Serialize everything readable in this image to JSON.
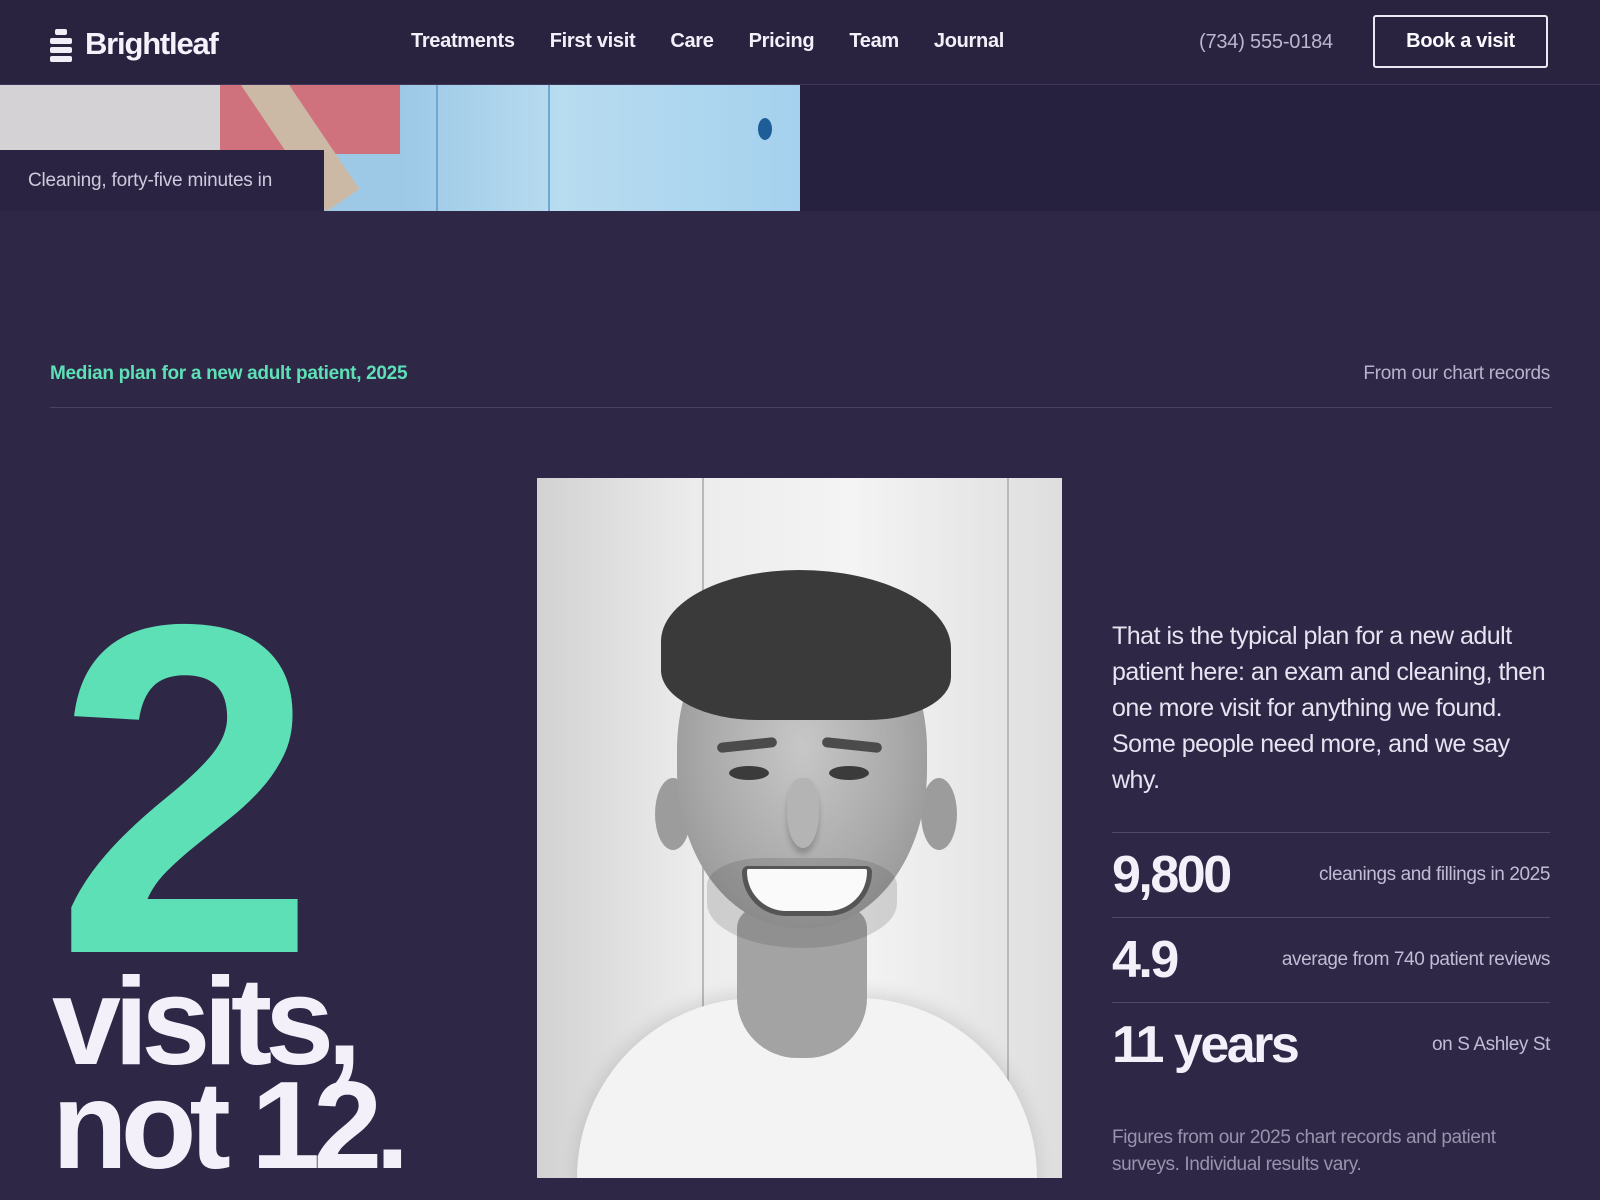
{
  "header": {
    "brand": "Brightleaf",
    "nav": [
      {
        "label": "Treatments"
      },
      {
        "label": "First visit"
      },
      {
        "label": "Care"
      },
      {
        "label": "Pricing"
      },
      {
        "label": "Team"
      },
      {
        "label": "Journal"
      }
    ],
    "phone": "(734) 555-0184",
    "cta_label": "Book a visit"
  },
  "hero_photo": {
    "caption": "Cleaning, forty-five minutes in"
  },
  "stat_section": {
    "kicker": "Median plan for a new adult patient, 2025",
    "source_note": "From our chart records",
    "big_number": "2",
    "headline_line1": "visits,",
    "headline_line2": "not 12.",
    "intro": "That is the typical plan for a new adult patient here: an exam and cleaning, then one more visit for anything we found. Some people need more, and we say why.",
    "stats": [
      {
        "value": "9,800",
        "label": "cleanings and fillings in 2025"
      },
      {
        "value": "4.9",
        "label": "average from 740 patient reviews"
      },
      {
        "value": "11 years",
        "label": "on S Ashley St"
      }
    ],
    "footnote": "Figures from our 2025 chart records and patient surveys. Individual results vary."
  },
  "colors": {
    "background": "#2e2746",
    "header_bg": "#292340",
    "accent": "#5ee0b7",
    "text": "#f3f0fa"
  },
  "icons": {
    "logo": "stacked-bars-logo-icon"
  }
}
